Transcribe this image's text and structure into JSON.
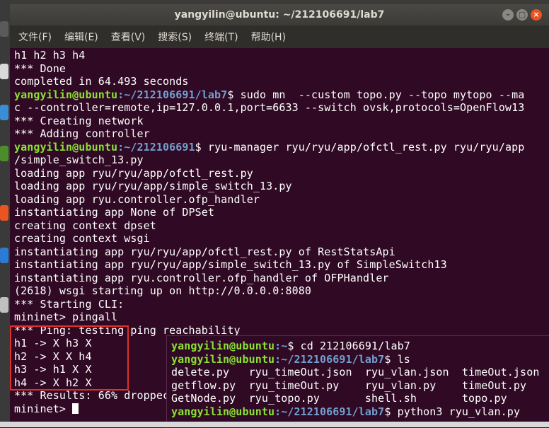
{
  "window": {
    "title": "yangyilin@ubuntu: ~/212106691/lab7",
    "buttons": {
      "minimize": "–",
      "maximize": "▢",
      "close": "×"
    }
  },
  "menu": [
    {
      "label": "文件(F)"
    },
    {
      "label": "编辑(E)"
    },
    {
      "label": "查看(V)"
    },
    {
      "label": "搜索(S)"
    },
    {
      "label": "终端(T)"
    },
    {
      "label": "帮助(H)"
    }
  ],
  "terminal_main": {
    "lines": [
      {
        "text": "h1 h2 h3 h4"
      },
      {
        "text": "*** Done"
      },
      {
        "text": "completed in 64.493 seconds"
      },
      {
        "user": "yangyilin@ubuntu",
        "path": ":~/212106691/lab7",
        "cmd": "$ sudo mn  --custom topo.py --topo mytopo --ma"
      },
      {
        "text": "c --controller=remote,ip=127.0.0.1,port=6633 --switch ovsk,protocols=OpenFlow13"
      },
      {
        "text": "*** Creating network"
      },
      {
        "text": "*** Adding controller"
      },
      {
        "user": "yangyilin@ubuntu",
        "path": ":~/212106691",
        "cmd": "$ ryu-manager ryu/ryu/app/ofctl_rest.py ryu/ryu/app"
      },
      {
        "text": "/simple_switch_13.py"
      },
      {
        "text": "loading app ryu/ryu/app/ofctl_rest.py"
      },
      {
        "text": "loading app ryu/ryu/app/simple_switch_13.py"
      },
      {
        "text": "loading app ryu.controller.ofp_handler"
      },
      {
        "text": "instantiating app None of DPSet"
      },
      {
        "text": "creating context dpset"
      },
      {
        "text": "creating context wsgi"
      },
      {
        "text": "instantiating app ryu/ryu/app/ofctl_rest.py of RestStatsApi"
      },
      {
        "text": "instantiating app ryu/ryu/app/simple_switch_13.py of SimpleSwitch13"
      },
      {
        "text": "instantiating app ryu.controller.ofp_handler of OFPHandler"
      },
      {
        "text": "(2618) wsgi starting up on http://0.0.0.0:8080"
      },
      {
        "text": "*** Starting CLI:"
      },
      {
        "text": "mininet> pingall"
      },
      {
        "text": "*** Ping: testing ping reachability"
      },
      {
        "text": "h1 -> X h3 X"
      },
      {
        "text": "h2 -> X X h4"
      },
      {
        "text": "h3 -> h1 X X"
      },
      {
        "text": "h4 -> X h2 X"
      },
      {
        "text": "*** Results: 66% droppec"
      },
      {
        "text": "mininet> "
      }
    ]
  },
  "terminal_overlay": {
    "lines": [
      {
        "user": "yangyilin@ubuntu",
        "path": ":~",
        "cmd": "$ cd 212106691/lab7"
      },
      {
        "user": "yangyilin@ubuntu",
        "path": ":~/212106691/lab7",
        "cmd": "$ ls"
      },
      {
        "text": "delete.py   ryu_timeOut.json  ryu_vlan.json  timeOut.json"
      },
      {
        "text": "getflow.py  ryu_timeOut.py    ryu_vlan.py    timeOut.py"
      },
      {
        "text": "GetNode.py  ryu_topo.py       shell.sh       topo.py"
      },
      {
        "user": "yangyilin@ubuntu",
        "path": ":~/212106691/lab7",
        "cmd": "$ python3 ryu_vlan.py"
      }
    ]
  },
  "colors": {
    "terminal_bg": "#300a24",
    "prompt_user": "#8ae234",
    "prompt_path": "#729fcf",
    "highlight_box": "#e0302b"
  }
}
